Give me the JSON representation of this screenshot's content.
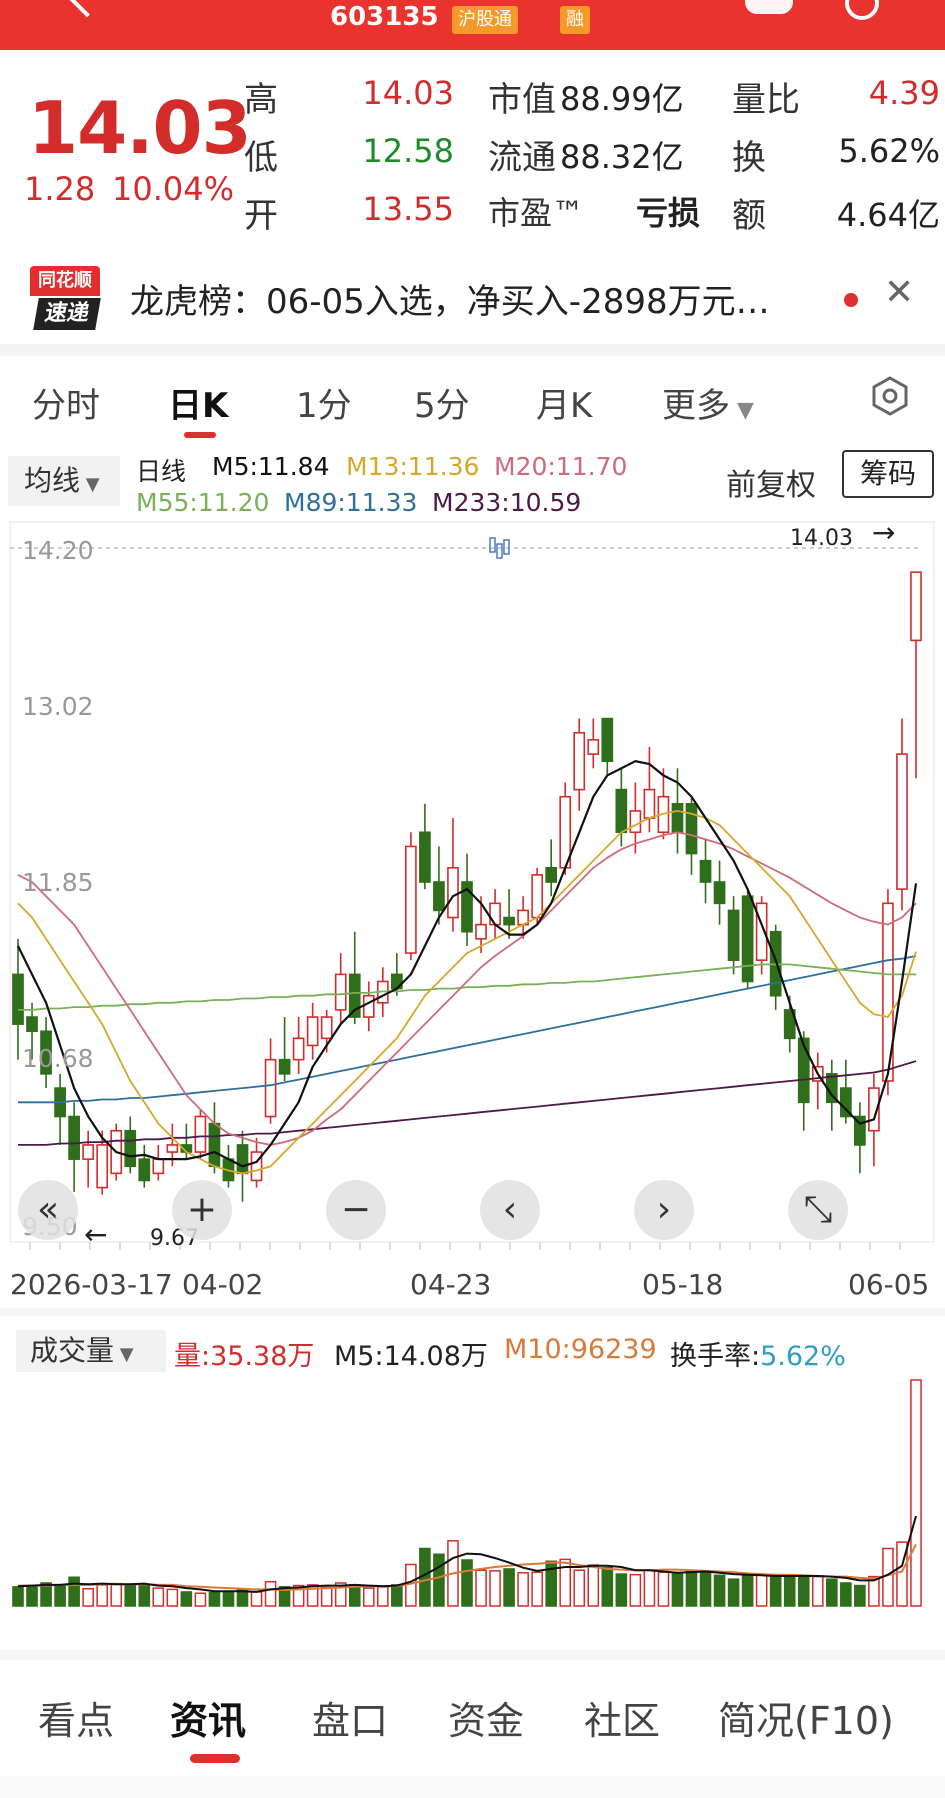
{
  "header": {
    "code": "603135",
    "badge_connect": "沪股通",
    "badge_margin": "融"
  },
  "quote": {
    "price": "14.03",
    "change": "1.28",
    "change_pct": "10.04%",
    "high_label": "高",
    "high": "14.03",
    "low_label": "低",
    "low": "12.58",
    "open_label": "开",
    "open": "13.55",
    "mcap_label": "市值",
    "mcap": "88.99亿",
    "float_label": "流通",
    "float": "88.32亿",
    "pe_label": "市盈™",
    "pe": "亏损",
    "vr_label": "量比",
    "vr": "4.39",
    "turnover_label": "换",
    "turnover": "5.62%",
    "amount_label": "额",
    "amount": "4.64亿"
  },
  "news": {
    "logo_top": "同花顺",
    "logo_bottom": "速递",
    "text": "龙虎榜：06-05入选，净买入-2898万元…"
  },
  "period_tabs": [
    "分时",
    "日K",
    "1分",
    "5分",
    "月K",
    "更多"
  ],
  "period_active": "日K",
  "ma": {
    "button": "均线",
    "line_label": "日线",
    "m5": "M5:11.84",
    "m13": "M13:11.36",
    "m20": "M20:11.70",
    "m55": "M55:11.20",
    "m89": "M89:11.33",
    "m233": "M233:10.59",
    "adjust": "前复权",
    "chip": "筹码"
  },
  "colors": {
    "up": "#d42b2b",
    "down": "#2f6e1a",
    "m5": "#111111",
    "m13": "#d4a92a",
    "m20": "#cf6b7a",
    "m55": "#79b058",
    "m89": "#2e6f9e",
    "m233": "#4b1a48"
  },
  "controls": [
    "«",
    "+",
    "−",
    "‹",
    "›",
    "⤡"
  ],
  "chart_data": [
    {
      "type": "candlestick",
      "title": "日K",
      "y_ticks": [
        "14.20",
        "13.02",
        "11.85",
        "10.68",
        "9.50"
      ],
      "ylim": [
        9.5,
        14.2
      ],
      "x_ticks": [
        "2026-03-17",
        "04-02",
        "04-23",
        "05-18",
        "06-05"
      ],
      "max_label": "14.03",
      "min_label": "9.67",
      "candles": [
        [
          11.2,
          11.45,
          10.6,
          10.85
        ],
        [
          10.9,
          11.0,
          10.6,
          10.8
        ],
        [
          10.8,
          10.9,
          10.4,
          10.5
        ],
        [
          10.4,
          10.5,
          10.0,
          10.2
        ],
        [
          10.2,
          10.3,
          9.67,
          9.9
        ],
        [
          9.9,
          10.1,
          9.7,
          10.0
        ],
        [
          9.7,
          10.1,
          9.65,
          10.0
        ],
        [
          9.8,
          10.15,
          9.75,
          10.1
        ],
        [
          10.1,
          10.2,
          9.8,
          9.85
        ],
        [
          9.9,
          10.0,
          9.7,
          9.75
        ],
        [
          9.8,
          10.0,
          9.75,
          9.9
        ],
        [
          9.95,
          10.15,
          9.85,
          10.0
        ],
        [
          10.0,
          10.15,
          9.9,
          9.95
        ],
        [
          9.95,
          10.25,
          9.9,
          10.2
        ],
        [
          10.15,
          10.3,
          9.8,
          9.85
        ],
        [
          9.9,
          10.0,
          9.7,
          9.75
        ],
        [
          10.0,
          10.1,
          9.6,
          9.8
        ],
        [
          9.75,
          10.05,
          9.7,
          9.95
        ],
        [
          10.2,
          10.75,
          10.15,
          10.6
        ],
        [
          10.6,
          10.9,
          10.45,
          10.5
        ],
        [
          10.6,
          10.9,
          10.5,
          10.75
        ],
        [
          10.7,
          11.0,
          10.6,
          10.9
        ],
        [
          10.75,
          10.95,
          10.65,
          10.9
        ],
        [
          10.95,
          11.35,
          10.85,
          11.2
        ],
        [
          11.2,
          11.5,
          10.85,
          10.9
        ],
        [
          10.9,
          11.15,
          10.8,
          11.05
        ],
        [
          11.0,
          11.25,
          10.9,
          11.15
        ],
        [
          11.2,
          11.35,
          11.05,
          11.1
        ],
        [
          11.35,
          12.2,
          11.3,
          12.1
        ],
        [
          12.2,
          12.4,
          11.8,
          11.85
        ],
        [
          11.85,
          12.1,
          11.55,
          11.65
        ],
        [
          11.6,
          12.3,
          11.5,
          11.95
        ],
        [
          11.85,
          12.05,
          11.4,
          11.5
        ],
        [
          11.45,
          11.75,
          11.35,
          11.55
        ],
        [
          11.55,
          11.8,
          11.45,
          11.7
        ],
        [
          11.6,
          11.8,
          11.45,
          11.55
        ],
        [
          11.55,
          11.75,
          11.45,
          11.65
        ],
        [
          11.6,
          11.95,
          11.55,
          11.9
        ],
        [
          11.95,
          12.15,
          11.75,
          11.85
        ],
        [
          11.95,
          12.55,
          11.9,
          12.45
        ],
        [
          12.5,
          13.0,
          12.35,
          12.9
        ],
        [
          12.75,
          13.0,
          12.65,
          12.85
        ],
        [
          13.0,
          13.0,
          12.6,
          12.7
        ],
        [
          12.5,
          12.65,
          12.1,
          12.2
        ],
        [
          12.2,
          12.55,
          12.05,
          12.35
        ],
        [
          12.3,
          12.8,
          12.2,
          12.5
        ],
        [
          12.2,
          12.65,
          12.15,
          12.45
        ],
        [
          12.4,
          12.65,
          12.05,
          12.2
        ],
        [
          12.4,
          12.45,
          11.9,
          12.05
        ],
        [
          12.0,
          12.15,
          11.7,
          11.85
        ],
        [
          11.85,
          12.0,
          11.55,
          11.7
        ],
        [
          11.65,
          11.75,
          11.2,
          11.3
        ],
        [
          11.75,
          11.8,
          11.1,
          11.15
        ],
        [
          11.3,
          11.75,
          11.2,
          11.7
        ],
        [
          11.5,
          11.55,
          10.95,
          11.05
        ],
        [
          10.95,
          11.05,
          10.65,
          10.75
        ],
        [
          10.75,
          10.8,
          10.1,
          10.3
        ],
        [
          10.45,
          10.65,
          10.25,
          10.55
        ],
        [
          10.5,
          10.6,
          10.1,
          10.3
        ],
        [
          10.4,
          10.6,
          10.15,
          10.2
        ],
        [
          10.2,
          10.3,
          9.8,
          10.0
        ],
        [
          10.1,
          10.5,
          9.85,
          10.4
        ],
        [
          10.45,
          11.8,
          10.35,
          11.7
        ],
        [
          11.8,
          13.0,
          11.65,
          12.75
        ],
        [
          13.55,
          14.03,
          12.58,
          14.03
        ]
      ],
      "ma5": [
        11.4,
        11.2,
        11.0,
        10.7,
        10.4,
        10.2,
        10.05,
        9.95,
        9.92,
        9.93,
        9.9,
        9.9,
        9.9,
        9.92,
        9.95,
        9.9,
        9.85,
        9.88,
        10.0,
        10.15,
        10.3,
        10.55,
        10.7,
        10.85,
        10.95,
        11.0,
        11.05,
        11.1,
        11.2,
        11.4,
        11.6,
        11.75,
        11.8,
        11.7,
        11.55,
        11.48,
        11.48,
        11.55,
        11.7,
        11.95,
        12.2,
        12.45,
        12.6,
        12.65,
        12.7,
        12.68,
        12.6,
        12.55,
        12.45,
        12.3,
        12.15,
        12.0,
        11.8,
        11.55,
        11.3,
        11.0,
        10.7,
        10.5,
        10.35,
        10.25,
        10.15,
        10.18,
        10.5,
        11.15,
        11.84
      ],
      "ma13": [
        11.7,
        11.6,
        11.45,
        11.3,
        11.15,
        11.0,
        10.85,
        10.65,
        10.45,
        10.3,
        10.15,
        10.05,
        9.95,
        9.9,
        9.85,
        9.82,
        9.8,
        9.82,
        9.85,
        9.95,
        10.05,
        10.15,
        10.25,
        10.35,
        10.45,
        10.55,
        10.65,
        10.75,
        10.9,
        11.05,
        11.15,
        11.25,
        11.35,
        11.4,
        11.45,
        11.5,
        11.55,
        11.6,
        11.7,
        11.8,
        11.9,
        12.0,
        12.1,
        12.2,
        12.25,
        12.3,
        12.33,
        12.35,
        12.33,
        12.3,
        12.25,
        12.15,
        12.05,
        11.95,
        11.85,
        11.75,
        11.6,
        11.45,
        11.3,
        11.15,
        11.0,
        10.92,
        10.9,
        11.05,
        11.36
      ],
      "ma20": [
        11.9,
        11.85,
        11.75,
        11.65,
        11.55,
        11.4,
        11.25,
        11.1,
        10.95,
        10.8,
        10.65,
        10.5,
        10.35,
        10.25,
        10.15,
        10.08,
        10.05,
        10.02,
        10.0,
        10.02,
        10.05,
        10.1,
        10.18,
        10.25,
        10.35,
        10.45,
        10.55,
        10.65,
        10.75,
        10.85,
        10.95,
        11.05,
        11.15,
        11.25,
        11.33,
        11.4,
        11.47,
        11.55,
        11.65,
        11.75,
        11.85,
        11.95,
        12.02,
        12.08,
        12.12,
        12.15,
        12.18,
        12.2,
        12.18,
        12.15,
        12.12,
        12.08,
        12.03,
        11.98,
        11.93,
        11.88,
        11.82,
        11.76,
        11.7,
        11.65,
        11.6,
        11.57,
        11.55,
        11.6,
        11.7
      ],
      "ma55": [
        10.95,
        10.95,
        10.96,
        10.96,
        10.97,
        10.97,
        10.98,
        10.98,
        10.99,
        10.99,
        11.0,
        11.0,
        11.01,
        11.01,
        11.02,
        11.02,
        11.03,
        11.03,
        11.04,
        11.04,
        11.05,
        11.05,
        11.06,
        11.06,
        11.07,
        11.07,
        11.08,
        11.08,
        11.09,
        11.09,
        11.1,
        11.1,
        11.11,
        11.11,
        11.12,
        11.12,
        11.13,
        11.13,
        11.14,
        11.14,
        11.15,
        11.15,
        11.16,
        11.17,
        11.18,
        11.19,
        11.2,
        11.21,
        11.22,
        11.23,
        11.24,
        11.25,
        11.26,
        11.27,
        11.27,
        11.27,
        11.26,
        11.25,
        11.24,
        11.23,
        11.22,
        11.21,
        11.2,
        11.2,
        11.2
      ],
      "ma89": [
        10.3,
        10.3,
        10.3,
        10.3,
        10.31,
        10.31,
        10.32,
        10.32,
        10.33,
        10.33,
        10.34,
        10.35,
        10.36,
        10.37,
        10.38,
        10.39,
        10.4,
        10.41,
        10.42,
        10.44,
        10.46,
        10.48,
        10.5,
        10.52,
        10.54,
        10.56,
        10.58,
        10.6,
        10.62,
        10.64,
        10.66,
        10.68,
        10.7,
        10.72,
        10.74,
        10.76,
        10.78,
        10.8,
        10.82,
        10.84,
        10.86,
        10.88,
        10.9,
        10.92,
        10.94,
        10.96,
        10.98,
        11.0,
        11.02,
        11.04,
        11.06,
        11.08,
        11.1,
        11.12,
        11.14,
        11.16,
        11.18,
        11.2,
        11.22,
        11.24,
        11.26,
        11.28,
        11.3,
        11.31,
        11.33
      ],
      "ma233": [
        10.0,
        10.0,
        10.0,
        10.01,
        10.01,
        10.02,
        10.02,
        10.03,
        10.03,
        10.04,
        10.04,
        10.05,
        10.05,
        10.06,
        10.06,
        10.07,
        10.07,
        10.08,
        10.08,
        10.09,
        10.1,
        10.11,
        10.12,
        10.13,
        10.14,
        10.15,
        10.16,
        10.17,
        10.18,
        10.19,
        10.2,
        10.21,
        10.22,
        10.23,
        10.24,
        10.25,
        10.26,
        10.27,
        10.28,
        10.29,
        10.3,
        10.31,
        10.32,
        10.33,
        10.34,
        10.35,
        10.36,
        10.37,
        10.38,
        10.39,
        10.4,
        10.41,
        10.42,
        10.43,
        10.44,
        10.45,
        10.46,
        10.47,
        10.48,
        10.49,
        10.5,
        10.51,
        10.53,
        10.56,
        10.59
      ]
    },
    {
      "type": "bar",
      "title": "成交量",
      "volume_label": "量:35.38万",
      "m5_label": "M5:14.08万",
      "m10_label": "M10:96239",
      "turnover_label": "换手率:",
      "turnover_value": "5.62%",
      "unit": "万手",
      "ylim": [
        0,
        36
      ],
      "volumes": [
        3.0,
        3.2,
        3.6,
        3.2,
        4.5,
        2.7,
        3.3,
        3.5,
        3.2,
        3.4,
        2.8,
        2.6,
        2.2,
        2.0,
        2.1,
        2.3,
        2.6,
        2.2,
        3.8,
        3.0,
        3.2,
        3.3,
        2.9,
        3.6,
        3.3,
        2.8,
        3.0,
        3.3,
        6.5,
        9.0,
        8.1,
        10.2,
        7.2,
        5.6,
        5.5,
        5.8,
        5.2,
        5.3,
        7.0,
        7.3,
        5.6,
        6.4,
        6.0,
        5.0,
        4.9,
        5.6,
        5.3,
        5.1,
        5.4,
        5.5,
        4.8,
        4.2,
        4.8,
        4.9,
        4.8,
        4.6,
        4.6,
        4.6,
        4.2,
        3.6,
        3.2,
        4.6,
        9.0,
        10.0,
        35.38
      ],
      "ma5": [
        3.1,
        3.2,
        3.3,
        3.3,
        3.5,
        3.4,
        3.5,
        3.4,
        3.4,
        3.5,
        3.2,
        3.1,
        2.8,
        2.6,
        2.3,
        2.3,
        2.3,
        2.2,
        2.6,
        2.8,
        2.9,
        3.1,
        3.2,
        3.2,
        3.3,
        3.2,
        3.1,
        3.2,
        3.8,
        4.9,
        6.1,
        7.5,
        8.2,
        8.1,
        7.5,
        6.8,
        6.0,
        5.5,
        5.8,
        6.1,
        6.1,
        6.3,
        6.3,
        6.1,
        5.6,
        5.6,
        5.4,
        5.2,
        5.3,
        5.4,
        5.2,
        5.0,
        4.9,
        4.8,
        4.7,
        4.7,
        4.7,
        4.7,
        4.6,
        4.4,
        4.0,
        4.0,
        4.9,
        6.3,
        14.08
      ],
      "ma10": [
        3.2,
        3.2,
        3.2,
        3.3,
        3.3,
        3.3,
        3.4,
        3.4,
        3.4,
        3.4,
        3.3,
        3.3,
        3.1,
        3.0,
        2.9,
        2.8,
        2.7,
        2.6,
        2.6,
        2.5,
        2.6,
        2.7,
        2.8,
        2.9,
        3.0,
        3.1,
        3.1,
        3.1,
        3.5,
        4.0,
        4.5,
        5.1,
        5.5,
        5.8,
        6.1,
        6.3,
        6.5,
        6.6,
        6.8,
        6.8,
        6.4,
        6.1,
        5.8,
        5.7,
        5.6,
        5.6,
        5.7,
        5.7,
        5.6,
        5.5,
        5.4,
        5.3,
        5.1,
        5.0,
        4.9,
        4.9,
        4.8,
        4.7,
        4.6,
        4.6,
        4.4,
        4.3,
        4.8,
        5.4,
        9.62
      ]
    }
  ],
  "bottom_tabs": [
    "看点",
    "资讯",
    "盘口",
    "资金",
    "社区",
    "简况(F10)"
  ],
  "bottom_active": "资讯"
}
